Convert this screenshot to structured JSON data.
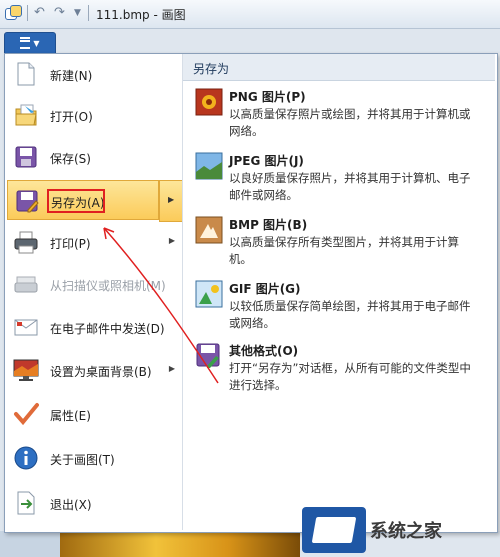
{
  "window": {
    "title": "111.bmp - 画图"
  },
  "menu_tab": {
    "label": "▼"
  },
  "menu": {
    "items": [
      {
        "key": "new",
        "label": "新建(N)",
        "has_arrow": false,
        "disabled": false
      },
      {
        "key": "open",
        "label": "打开(O)",
        "has_arrow": false,
        "disabled": false
      },
      {
        "key": "save",
        "label": "保存(S)",
        "has_arrow": false,
        "disabled": false
      },
      {
        "key": "saveas",
        "label": "另存为(A)",
        "has_arrow": true,
        "disabled": false
      },
      {
        "key": "print",
        "label": "打印(P)",
        "has_arrow": true,
        "disabled": false
      },
      {
        "key": "scan",
        "label": "从扫描仪或照相机(M)",
        "has_arrow": false,
        "disabled": true
      },
      {
        "key": "email",
        "label": "在电子邮件中发送(D)",
        "has_arrow": false,
        "disabled": false
      },
      {
        "key": "desktop",
        "label": "设置为桌面背景(B)",
        "has_arrow": true,
        "disabled": false
      },
      {
        "key": "props",
        "label": "属性(E)",
        "has_arrow": false,
        "disabled": false
      },
      {
        "key": "about",
        "label": "关于画图(T)",
        "has_arrow": false,
        "disabled": false
      },
      {
        "key": "exit",
        "label": "退出(X)",
        "has_arrow": false,
        "disabled": false
      }
    ]
  },
  "submenu": {
    "title": "另存为",
    "options": [
      {
        "title": "PNG 图片(P)",
        "desc": "以高质量保存照片或绘图，并将其用于计算机或网络。"
      },
      {
        "title": "JPEG 图片(J)",
        "desc": "以良好质量保存照片，并将其用于计算机、电子邮件或网络。"
      },
      {
        "title": "BMP 图片(B)",
        "desc": "以高质量保存所有类型图片，并将其用于计算机。"
      },
      {
        "title": "GIF 图片(G)",
        "desc": "以较低质量保存简单绘图，并将其用于电子邮件或网络。"
      },
      {
        "title": "其他格式(O)",
        "desc": "打开“另存为”对话框，从所有可能的文件类型中进行选择。"
      }
    ]
  },
  "watermark": {
    "text": "系统之家"
  },
  "colors": {
    "accent": "#2a66b4",
    "highlight": "#fbcb5a",
    "annotation": "#e02020"
  }
}
